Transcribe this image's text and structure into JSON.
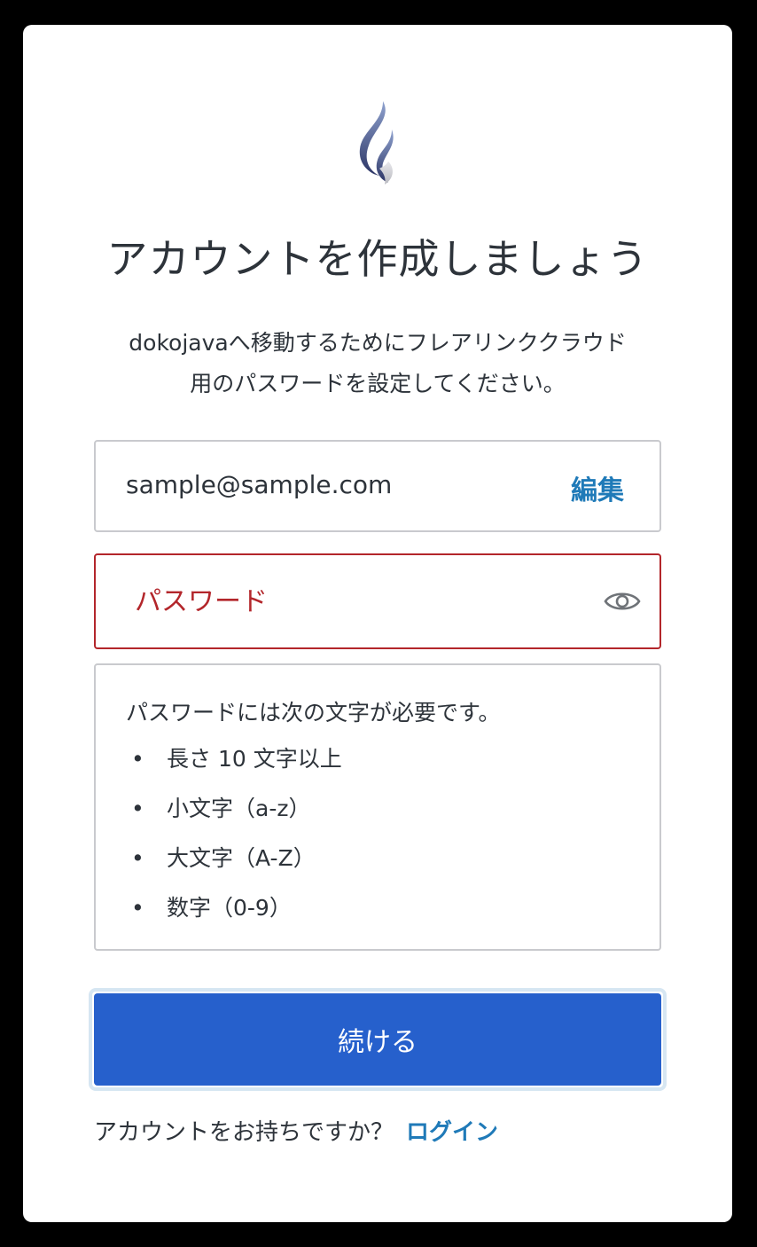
{
  "header": {
    "title": "アカウントを作成しましょう",
    "subtitle_line1": "dokojavaへ移動するためにフレアリンククラウド",
    "subtitle_line2": "用のパスワードを設定してください。"
  },
  "form": {
    "email_value": "sample@sample.com",
    "edit_label": "編集",
    "password_placeholder": "パスワード",
    "password_value": "",
    "show_password_icon": "eye-icon"
  },
  "requirements": {
    "heading": "パスワードには次の文字が必要です。",
    "bullet": "•",
    "items": [
      "長さ 10 文字以上",
      "小文字（a-z）",
      "大文字（A-Z）",
      "数字（0-9）"
    ]
  },
  "actions": {
    "continue_label": "続ける",
    "login_prompt": "アカウントをお持ちですか？",
    "login_label": "ログイン"
  },
  "colors": {
    "primary_button": "#2660cc",
    "link": "#1f7ab8",
    "error": "#b3262b",
    "text": "#2d333a",
    "border": "#c9cace"
  }
}
